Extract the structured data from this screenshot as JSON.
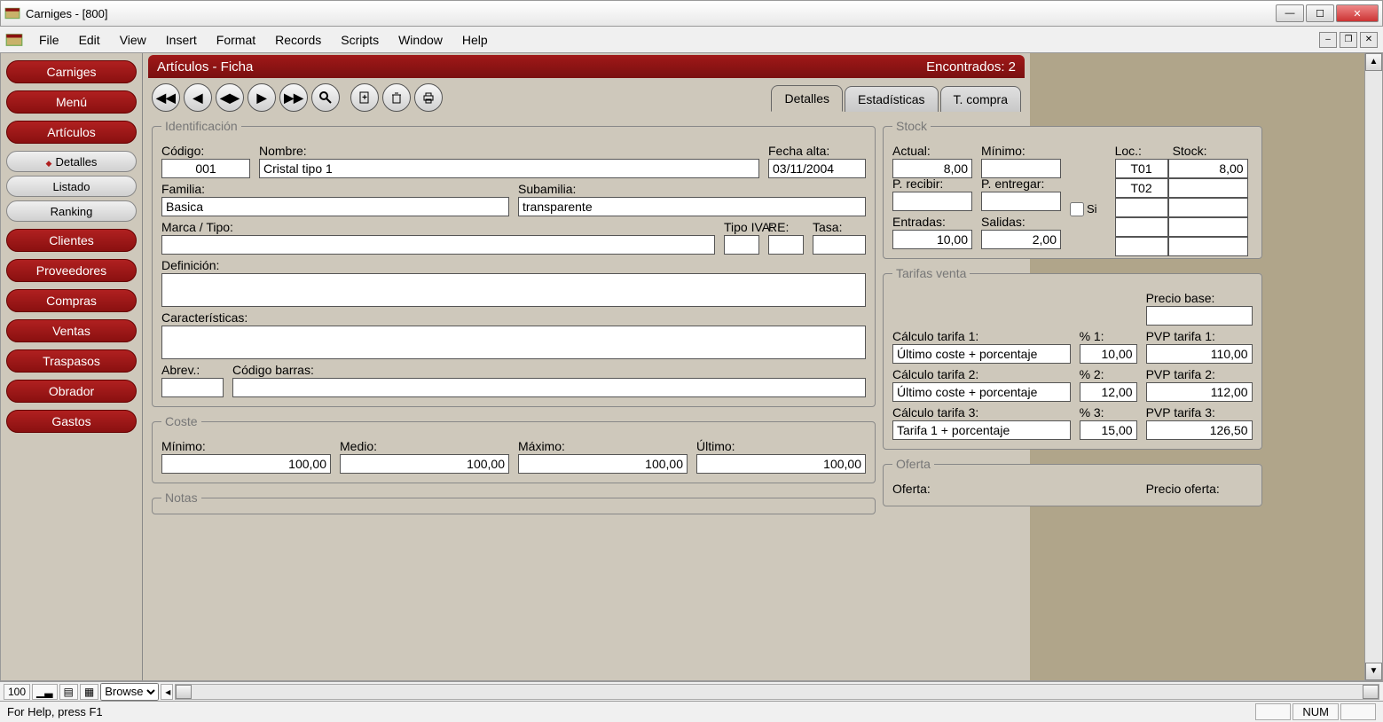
{
  "titlebar": {
    "title": "Carniges - [800]"
  },
  "menubar": {
    "items": [
      "File",
      "Edit",
      "View",
      "Insert",
      "Format",
      "Records",
      "Scripts",
      "Window",
      "Help"
    ]
  },
  "sidebar": {
    "carniges": "Carniges",
    "menu": "Menú",
    "articulos": "Artículos",
    "detalles": "Detalles",
    "listado": "Listado",
    "ranking": "Ranking",
    "clientes": "Clientes",
    "proveedores": "Proveedores",
    "compras": "Compras",
    "ventas": "Ventas",
    "traspasos": "Traspasos",
    "obrador": "Obrador",
    "gastos": "Gastos"
  },
  "header": {
    "title": "Artículos - Ficha",
    "found": "Encontrados: 2"
  },
  "tabs": {
    "detalles": "Detalles",
    "estadisticas": "Estadísticas",
    "tcompra": "T. compra"
  },
  "legends": {
    "ident": "Identificación",
    "stock": "Stock",
    "tarifas": "Tarifas venta",
    "coste": "Coste",
    "notas": "Notas",
    "oferta": "Oferta"
  },
  "labels": {
    "codigo": "Código:",
    "nombre": "Nombre:",
    "fecha_alta": "Fecha alta:",
    "familia": "Familia:",
    "subfamilia": "Subamilia:",
    "marca": "Marca / Tipo:",
    "tipo_iva": "Tipo IVA:",
    "re": "RE:",
    "tasa": "Tasa:",
    "definicion": "Definición:",
    "caracteristicas": "Características:",
    "abrev": "Abrev.:",
    "codigo_barras": "Código barras:",
    "minimo": "Mínimo:",
    "medio": "Medio:",
    "maximo": "Máximo:",
    "ultimo": "Último:",
    "actual": "Actual:",
    "stmin": "Mínimo:",
    "si": "Si",
    "loc": "Loc.:",
    "stock": "Stock:",
    "precibir": "P. recibir:",
    "pentregar": "P. entregar:",
    "entradas": "Entradas:",
    "salidas": "Salidas:",
    "precio_base": "Precio base:",
    "calc1": "Cálculo tarifa 1:",
    "pct1": "% 1:",
    "pvp1": "PVP tarifa 1:",
    "calc2": "Cálculo tarifa 2:",
    "pct2": "% 2:",
    "pvp2": "PVP tarifa 2:",
    "calc3": "Cálculo tarifa 3:",
    "pct3": "% 3:",
    "pvp3": "PVP tarifa 3:",
    "oferta": "Oferta:",
    "precio_oferta": "Precio oferta:"
  },
  "values": {
    "codigo": "001",
    "nombre": "Cristal tipo 1",
    "fecha_alta": "03/11/2004",
    "familia": "Basica",
    "subfamilia": "transparente",
    "marca": "",
    "tipo_iva": "",
    "re": "",
    "tasa": "",
    "definicion": "",
    "caracteristicas": "",
    "abrev": "",
    "codigo_barras": "",
    "coste_min": "100,00",
    "coste_med": "100,00",
    "coste_max": "100,00",
    "coste_ult": "100,00",
    "actual": "8,00",
    "stmin": "",
    "precibir": "",
    "pentregar": "",
    "entradas": "10,00",
    "salidas": "2,00",
    "loc1": "T01",
    "stock1": "8,00",
    "loc2": "T02",
    "stock2": "",
    "precio_base": "",
    "calc1": "Último coste + porcentaje",
    "pct1": "10,00",
    "pvp1": "110,00",
    "calc2": "Último coste + porcentaje",
    "pct2": "12,00",
    "pvp2": "112,00",
    "calc3": "Tarifa 1 + porcentaje",
    "pct3": "15,00",
    "pvp3": "126,50"
  },
  "status": {
    "zoom": "100",
    "mode": "Browse",
    "help": "For Help, press F1",
    "num": "NUM"
  }
}
